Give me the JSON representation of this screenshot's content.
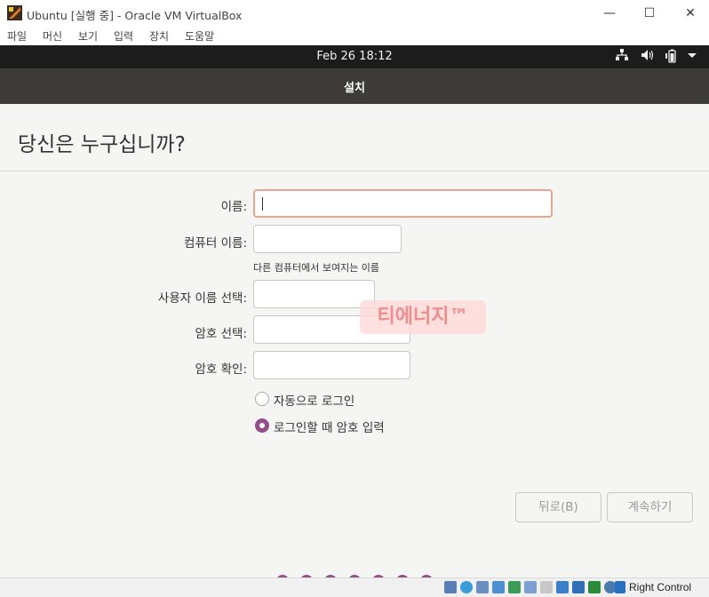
{
  "window": {
    "title": "Ubuntu [실행 중] - Oracle VM VirtualBox",
    "minimize": "—",
    "maximize": "☐",
    "close": "✕"
  },
  "menu": [
    "파일",
    "머신",
    "보기",
    "입력",
    "장치",
    "도움말"
  ],
  "top_panel": {
    "clock": "Feb 26  18:12",
    "icons": [
      "network-icon",
      "volume-icon",
      "battery-icon",
      "dropdown-arrow-icon"
    ]
  },
  "installer": {
    "header_title": "설치",
    "heading": "당신은 누구십니까?",
    "fields": {
      "name_label": "이름:",
      "name_value": "",
      "computer_label": "컴퓨터 이름:",
      "computer_value": "",
      "computer_hint": "다른 컴퓨터에서 보여지는 이름",
      "username_label": "사용자 이름 선택:",
      "username_value": "",
      "password_label": "암호 선택:",
      "password_value": "",
      "confirm_label": "암호 확인:",
      "confirm_value": ""
    },
    "login_options": {
      "auto_login": "자동으로 로그인",
      "require_password": "로그인할 때 암호 입력",
      "selected": "require_password"
    },
    "buttons": {
      "back": "뒤로(B)",
      "continue": "계속하기"
    },
    "watermark": "티에너지™"
  },
  "statusbar": {
    "host_key": "Right Control"
  },
  "colors": {
    "accent": "#924d8b",
    "focus_border": "#e9a58d",
    "header_bg": "#3c3b37",
    "panel_bg": "#1c1c1c"
  }
}
